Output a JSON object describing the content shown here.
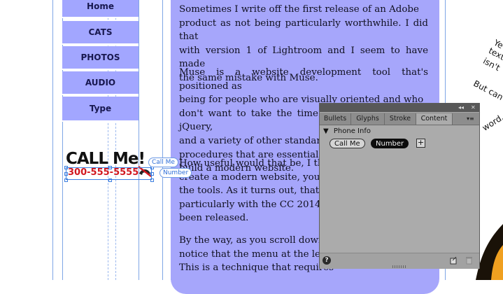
{
  "menu": {
    "items": [
      "Home",
      "CATS",
      "PHOTOS",
      "AUDIO",
      "Type"
    ]
  },
  "article": {
    "paragraphs": [
      [
        "Sometimes I write off the first release of an Adobe",
        "product as not being particularly worthwhile. I did that",
        "with version 1 of Lightroom and I seem to have made",
        "the same mistake with Muse."
      ],
      [
        "Muse is a website development tool that's positioned as",
        "being for people who are visually oriented and who",
        "don't want to take the time to learn HTML, CSS, jQuery,",
        "and a variety of other standards",
        "procedures that are essential for",
        "build a modern website."
      ],
      [
        "How useful would that be, I tho",
        "create a modern website, you h",
        "the tools. As it turns out, that's",
        "particularly with the CC 2014 ve",
        "been released."
      ],
      [
        "By the way, as you scroll down",
        "notice that the menu at the left",
        "This is a technique that requires"
      ]
    ]
  },
  "widget": {
    "heading": "CALL Me!",
    "phone": "300-555-5555",
    "tag_call": "Call Me",
    "tag_number": "Number"
  },
  "right_text": {
    "line1": "Ye",
    "line2": "text",
    "line3": "isn't",
    "line4": "But can",
    "line5": "word,"
  },
  "panel": {
    "tabs": [
      "Bullets",
      "Glyphs",
      "Stroke",
      "Content"
    ],
    "active_tab": "Content",
    "section_title": "Phone Info",
    "pill_callme": "Call Me",
    "pill_number": "Number",
    "add_symbol": "+",
    "collapse_symbol": "◂◂",
    "close_symbol": "✕",
    "menu_symbol": "▾≡",
    "help_symbol": "?"
  },
  "colors": {
    "menu_bg": "#a2a6ff",
    "article_bg": "#a6a6fb",
    "phone_red": "#d2181f",
    "guide_blue": "#7fa6e6",
    "panel_gray": "#ababab"
  }
}
